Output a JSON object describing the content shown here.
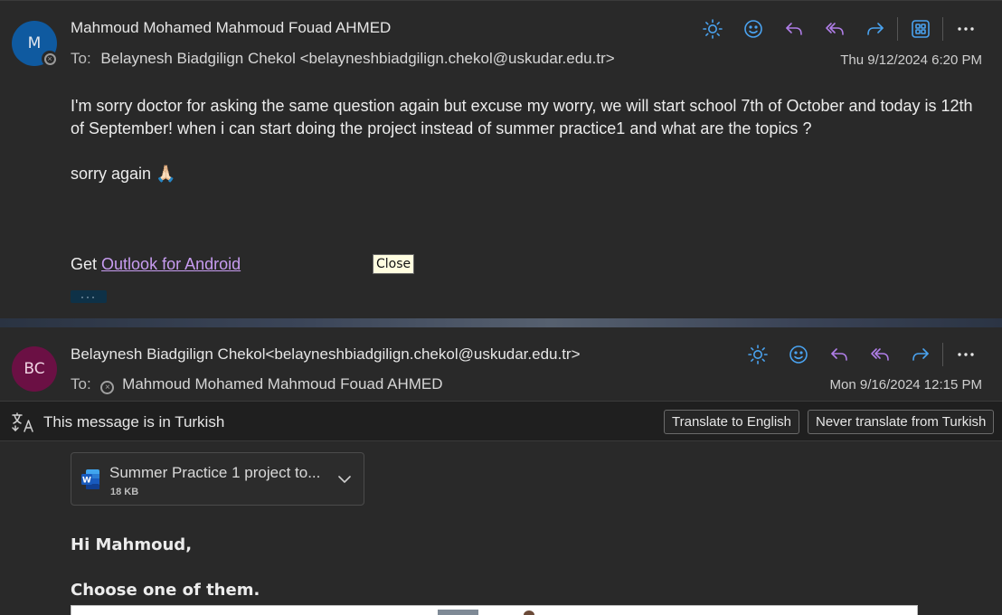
{
  "message1": {
    "avatar_initials": "M",
    "sender": "Mahmoud Mohamed Mahmoud Fouad AHMED",
    "to_label": "To:",
    "to": "Belaynesh Biadgilign Chekol <belayneshbiadgilign.chekol@uskudar.edu.tr>",
    "date": "Thu 9/12/2024 6:20 PM",
    "body_paragraph1": "I'm sorry doctor for asking the same question again but excuse my worry, we will start school 7th of October and today is 12th of September! when i can start doing the project instead of summer practice1 and what are the topics ?",
    "body_paragraph2": "sorry again 🙏🏻",
    "signature_prefix": "Get",
    "signature_link": "Outlook for Android",
    "tooltip": "Close",
    "more_label": "···"
  },
  "message2": {
    "avatar_initials": "BC",
    "sender": "Belaynesh Biadgilign Chekol<belayneshbiadgilign.chekol@uskudar.edu.tr>",
    "to_label": "To:",
    "to": "Mahmoud Mohamed Mahmoud Fouad AHMED",
    "date": "Mon 9/16/2024 12:15 PM",
    "greeting": "Hi Mahmoud,",
    "instruction": "Choose one of them."
  },
  "translate_bar": {
    "text": "This message is in Turkish",
    "translate_button": "Translate to English",
    "never_button": "Never translate from Turkish"
  },
  "attachment": {
    "name": "Summer Practice 1 project to...",
    "size": "18 KB"
  },
  "colors": {
    "accent_blue": "#4aa3f0",
    "accent_purple": "#b07ee8",
    "link": "#c79cf0",
    "avatar_m": "#0f5aa0",
    "avatar_bc": "#6b1044"
  },
  "toolbar_icons_msg1": [
    "sun-icon",
    "emoji-icon",
    "reply-icon",
    "reply-all-icon",
    "forward-icon",
    "apps-icon",
    "more-icon"
  ],
  "toolbar_icons_msg2": [
    "sun-icon",
    "emoji-icon",
    "reply-icon",
    "reply-all-icon",
    "forward-icon",
    "more-icon"
  ]
}
